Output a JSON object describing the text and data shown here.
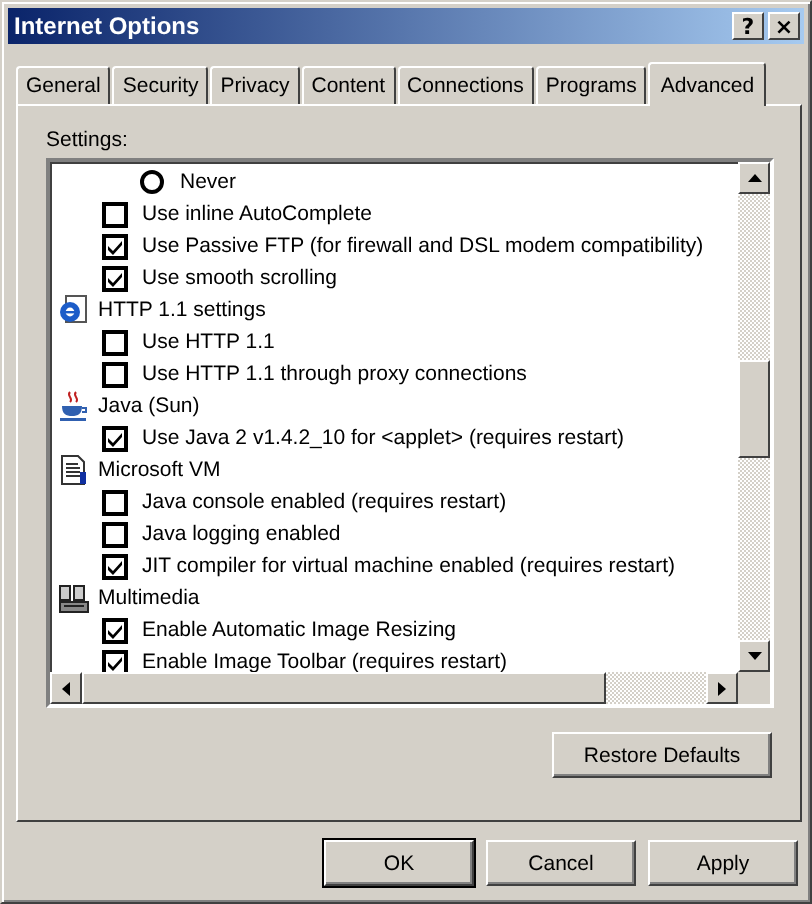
{
  "window": {
    "title": "Internet Options",
    "title_buttons": [
      "?",
      "×"
    ]
  },
  "tabs": [
    {
      "label": "General",
      "selected": false
    },
    {
      "label": "Security",
      "selected": false
    },
    {
      "label": "Privacy",
      "selected": false
    },
    {
      "label": "Content",
      "selected": false
    },
    {
      "label": "Connections",
      "selected": false
    },
    {
      "label": "Programs",
      "selected": false
    },
    {
      "label": "Advanced",
      "selected": true
    }
  ],
  "settings_label": "Settings:",
  "settings": [
    {
      "kind": "radio",
      "label": "Never",
      "checked": false
    },
    {
      "kind": "checkbox",
      "label": "Use inline AutoComplete",
      "checked": false
    },
    {
      "kind": "checkbox",
      "label": "Use Passive FTP (for firewall and DSL modem compatibility)",
      "checked": true
    },
    {
      "kind": "checkbox",
      "label": "Use smooth scrolling",
      "checked": true
    },
    {
      "kind": "group",
      "label": "HTTP 1.1 settings"
    },
    {
      "kind": "checkbox",
      "label": "Use HTTP 1.1",
      "checked": false
    },
    {
      "kind": "checkbox",
      "label": "Use HTTP 1.1 through proxy connections",
      "checked": false
    },
    {
      "kind": "group",
      "label": "Java (Sun)"
    },
    {
      "kind": "checkbox",
      "label": "Use Java 2 v1.4.2_10 for <applet> (requires restart)",
      "checked": true
    },
    {
      "kind": "group",
      "label": "Microsoft VM"
    },
    {
      "kind": "checkbox",
      "label": "Java console enabled (requires restart)",
      "checked": false
    },
    {
      "kind": "checkbox",
      "label": "Java logging enabled",
      "checked": false
    },
    {
      "kind": "checkbox",
      "label": "JIT compiler for virtual machine enabled (requires restart)",
      "checked": true
    },
    {
      "kind": "group",
      "label": "Multimedia"
    },
    {
      "kind": "checkbox",
      "label": "Enable Automatic Image Resizing",
      "checked": true
    },
    {
      "kind": "checkbox",
      "label": "Enable Image Toolbar (requires restart)",
      "checked": true
    }
  ],
  "restore_button": "Restore Defaults",
  "buttons": [
    "OK",
    "Cancel",
    "Apply"
  ]
}
